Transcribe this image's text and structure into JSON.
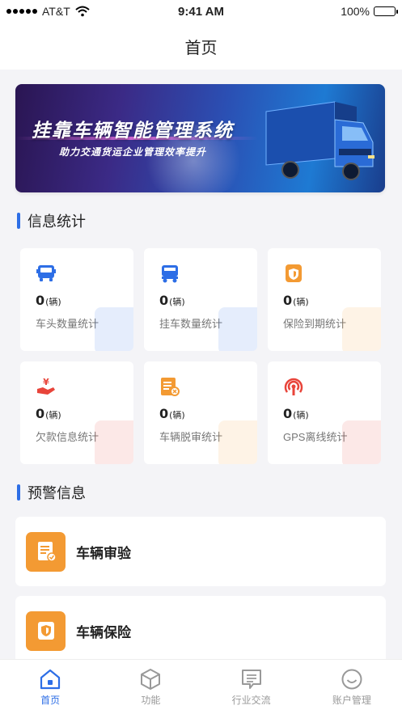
{
  "status_bar": {
    "carrier": "AT&T",
    "time": "9:41 AM",
    "battery": "100%"
  },
  "nav": {
    "title": "首页"
  },
  "banner": {
    "title": "挂靠车辆智能管理系统",
    "subtitle": "助力交通货运企业管理效率提升"
  },
  "info_section": {
    "title": "信息统计"
  },
  "stats": [
    {
      "value": "0",
      "unit": "(辆)",
      "label": "车头数量统计",
      "icon": "truck-head-icon",
      "color": "#2d6ee6"
    },
    {
      "value": "0",
      "unit": "(辆)",
      "label": "挂车数量统计",
      "icon": "trailer-icon",
      "color": "#2d6ee6"
    },
    {
      "value": "0",
      "unit": "(辆)",
      "label": "保险到期统计",
      "icon": "insurance-icon",
      "color": "#f39a33"
    },
    {
      "value": "0",
      "unit": "(辆)",
      "label": "欠款信息统计",
      "icon": "debt-icon",
      "color": "#e8443a"
    },
    {
      "value": "0",
      "unit": "(辆)",
      "label": "车辆脱审统计",
      "icon": "inspection-icon",
      "color": "#f39a33"
    },
    {
      "value": "0",
      "unit": "(辆)",
      "label": "GPS离线统计",
      "icon": "gps-icon",
      "color": "#e8443a"
    }
  ],
  "warn_section": {
    "title": "预警信息"
  },
  "warnings": [
    {
      "label": "车辆审验",
      "icon": "vehicle-inspection-icon"
    },
    {
      "label": "车辆保险",
      "icon": "vehicle-insurance-icon"
    }
  ],
  "tabs": [
    {
      "label": "首页",
      "icon": "home-icon",
      "active": true
    },
    {
      "label": "功能",
      "icon": "cube-icon",
      "active": false
    },
    {
      "label": "行业交流",
      "icon": "chat-icon",
      "active": false
    },
    {
      "label": "账户管理",
      "icon": "smile-icon",
      "active": false
    }
  ],
  "colors": {
    "accent": "#2d6ee6",
    "warning": "#f39a33",
    "danger": "#e8443a"
  }
}
